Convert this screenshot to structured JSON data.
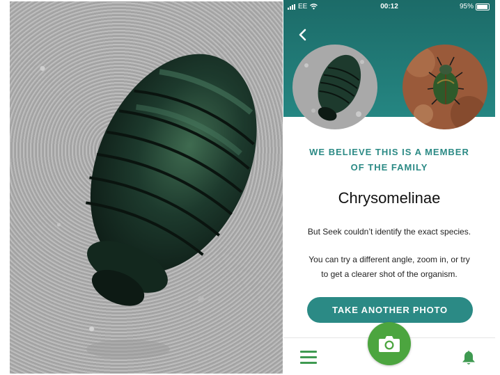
{
  "status_bar": {
    "carrier": "EE",
    "time": "00:12",
    "battery_percent": "95%",
    "battery_level": 0.95
  },
  "result": {
    "heading_line1": "WE BELIEVE THIS IS A MEMBER",
    "heading_line2": "OF THE FAMILY",
    "family_name": "Chrysomelinae",
    "text1": "But Seek couldn’t identify the exact species.",
    "text2_line1": "You can try a different angle, zoom in, or try",
    "text2_line2": "to get a clearer shot of the organism."
  },
  "actions": {
    "take_another_photo": "TAKE ANOTHER PHOTO"
  },
  "icons": {
    "back": "chevron-left-icon",
    "menu": "menu-icon",
    "camera": "camera-icon",
    "notifications": "bell-icon"
  },
  "colors": {
    "header_teal": "#1c6b68",
    "heading_teal": "#2b8a85",
    "button_teal": "#2b8a85",
    "camera_green": "#4ca53f",
    "nav_green": "#3f9a51"
  }
}
